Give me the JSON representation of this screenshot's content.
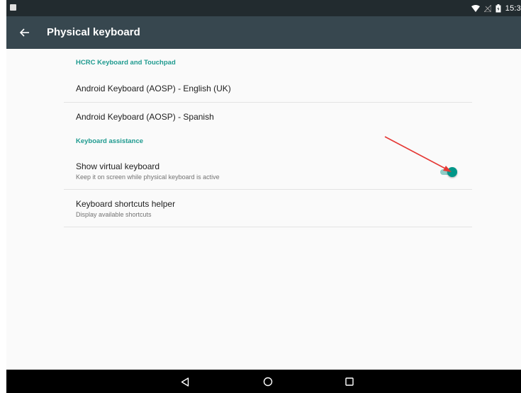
{
  "status_bar": {
    "time": "15:3"
  },
  "app_bar": {
    "title": "Physical keyboard"
  },
  "sections": [
    {
      "header": "HCRC Keyboard and Touchpad",
      "items": [
        {
          "title": "Android Keyboard (AOSP) - English (UK)"
        },
        {
          "title": "Android Keyboard (AOSP) - Spanish"
        }
      ]
    },
    {
      "header": "Keyboard assistance",
      "items": [
        {
          "title": "Show virtual keyboard",
          "summary": "Keep it on screen while physical keyboard is active",
          "switch_on": true
        },
        {
          "title": "Keyboard shortcuts helper",
          "summary": "Display available shortcuts"
        }
      ]
    }
  ],
  "colors": {
    "accent": "#009688",
    "section_header": "#1e9a8f",
    "app_bar": "#37474f",
    "status_bar": "#222b2f",
    "annotation_arrow": "#e53935"
  },
  "icons": {
    "back": "arrow-left-icon",
    "nav_back": "triangle-back-icon",
    "nav_home": "circle-home-icon",
    "nav_recents": "square-recents-icon"
  }
}
